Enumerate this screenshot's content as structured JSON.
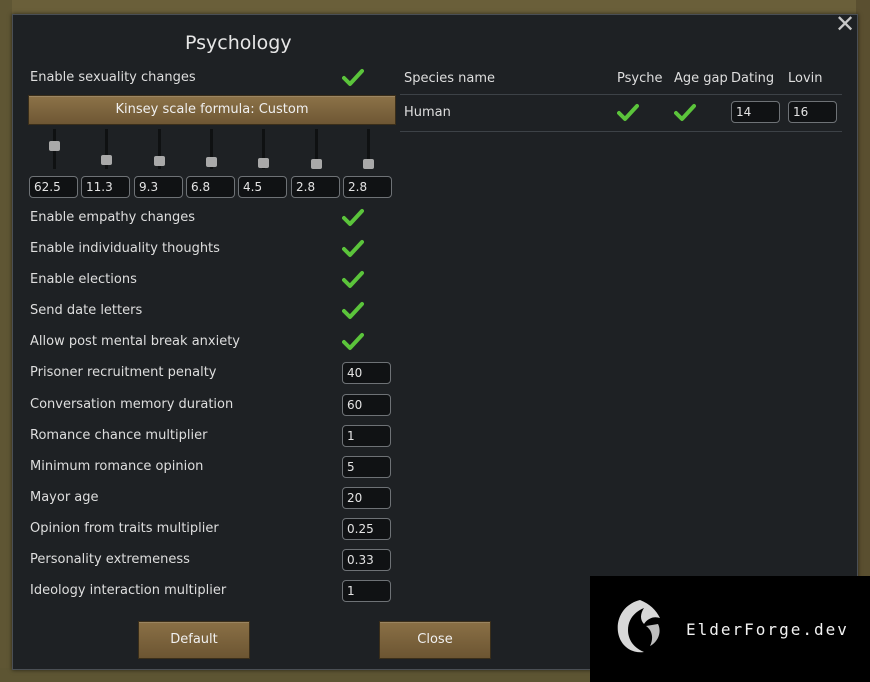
{
  "window": {
    "title": "Psychology",
    "close_glyph": "✕"
  },
  "settings": {
    "sexuality_label": "Enable sexuality changes",
    "sexuality_enabled": true,
    "kinsey_button": "Kinsey scale formula: Custom",
    "kinsey_values": [
      "62.5",
      "11.3",
      "9.3",
      "6.8",
      "4.5",
      "2.8",
      "2.8"
    ],
    "toggles": [
      {
        "label": "Enable empathy changes",
        "checked": true
      },
      {
        "label": "Enable individuality thoughts",
        "checked": true
      },
      {
        "label": "Enable elections",
        "checked": true
      },
      {
        "label": "Send date letters",
        "checked": true
      },
      {
        "label": "Allow post mental break anxiety",
        "checked": true
      }
    ],
    "numeric": [
      {
        "label": "Prisoner recruitment penalty",
        "value": "40"
      },
      {
        "label": "Conversation memory duration",
        "value": "60"
      },
      {
        "label": "Romance chance multiplier",
        "value": "1"
      },
      {
        "label": "Minimum romance opinion",
        "value": "5"
      },
      {
        "label": "Mayor age",
        "value": "20"
      },
      {
        "label": "Opinion from traits multiplier",
        "value": "0.25"
      },
      {
        "label": "Personality extremeness",
        "value": "0.33"
      },
      {
        "label": "Ideology interaction multiplier",
        "value": "1"
      }
    ]
  },
  "species_table": {
    "headers": [
      "Species name",
      "Psyche",
      "Age gap",
      "Dating",
      "Lovin"
    ],
    "rows": [
      {
        "name": "Human",
        "psyche": true,
        "age_gap": true,
        "dating": "14",
        "lovin": "16"
      }
    ]
  },
  "footer": {
    "default_label": "Default",
    "close_label": "Close"
  },
  "watermark": {
    "text": "ElderForge.dev",
    "icon": "dragon-logo-icon"
  },
  "colors": {
    "check_green": "#5bc43b",
    "panel_bg": "#1e2124",
    "button_brown": "#7d6440"
  }
}
